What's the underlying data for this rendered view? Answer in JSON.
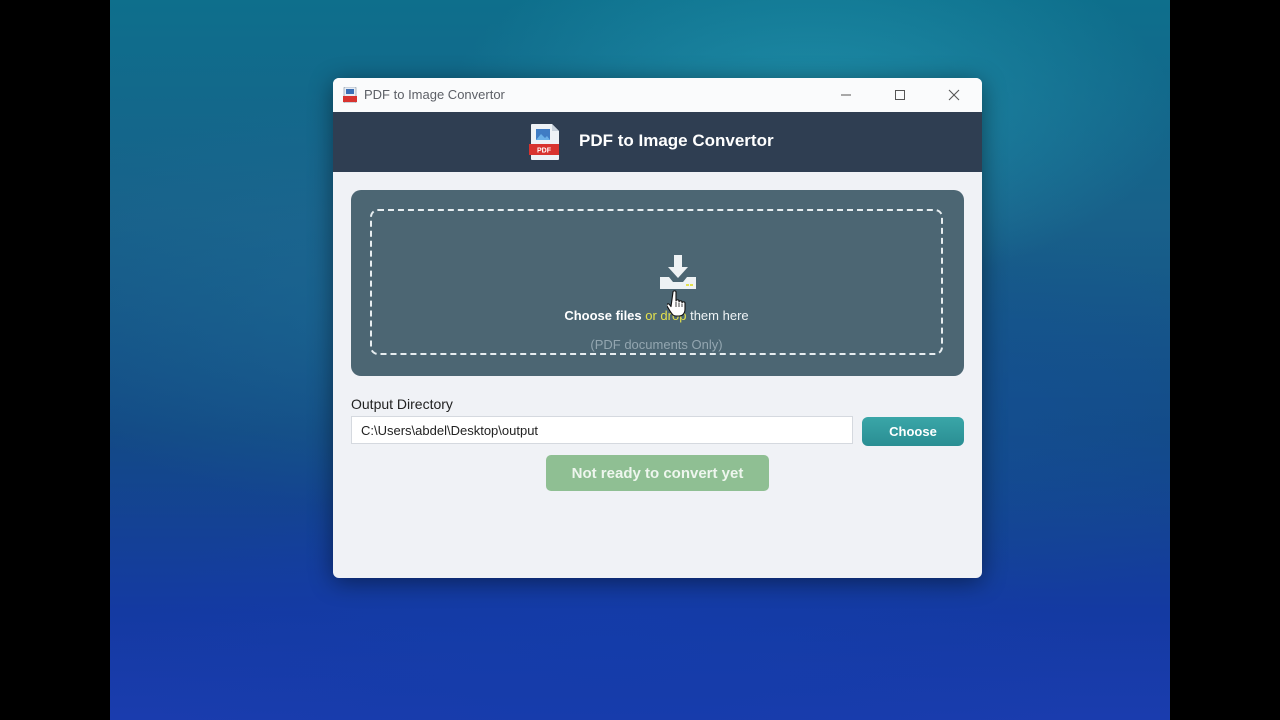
{
  "window": {
    "title": "PDF to Image Convertor",
    "controls": {
      "minimize": "—",
      "maximize": "☐",
      "close": "✕"
    }
  },
  "header": {
    "title": "PDF to Image Convertor"
  },
  "dropzone": {
    "choose_files": "Choose files",
    "or_drop": "or drop",
    "them_here": "them here",
    "hint": "(PDF documents Only)"
  },
  "output": {
    "label": "Output Directory",
    "path": "C:\\Users\\abdel\\Desktop\\output",
    "choose_button": "Choose"
  },
  "convert_button": "Not ready to convert yet",
  "colors": {
    "header": "#2f3e52",
    "dropzone": "#4c6673",
    "accent": "#2f9a9e",
    "convert_disabled": "#8fbf93",
    "highlight": "#e4e14c"
  }
}
